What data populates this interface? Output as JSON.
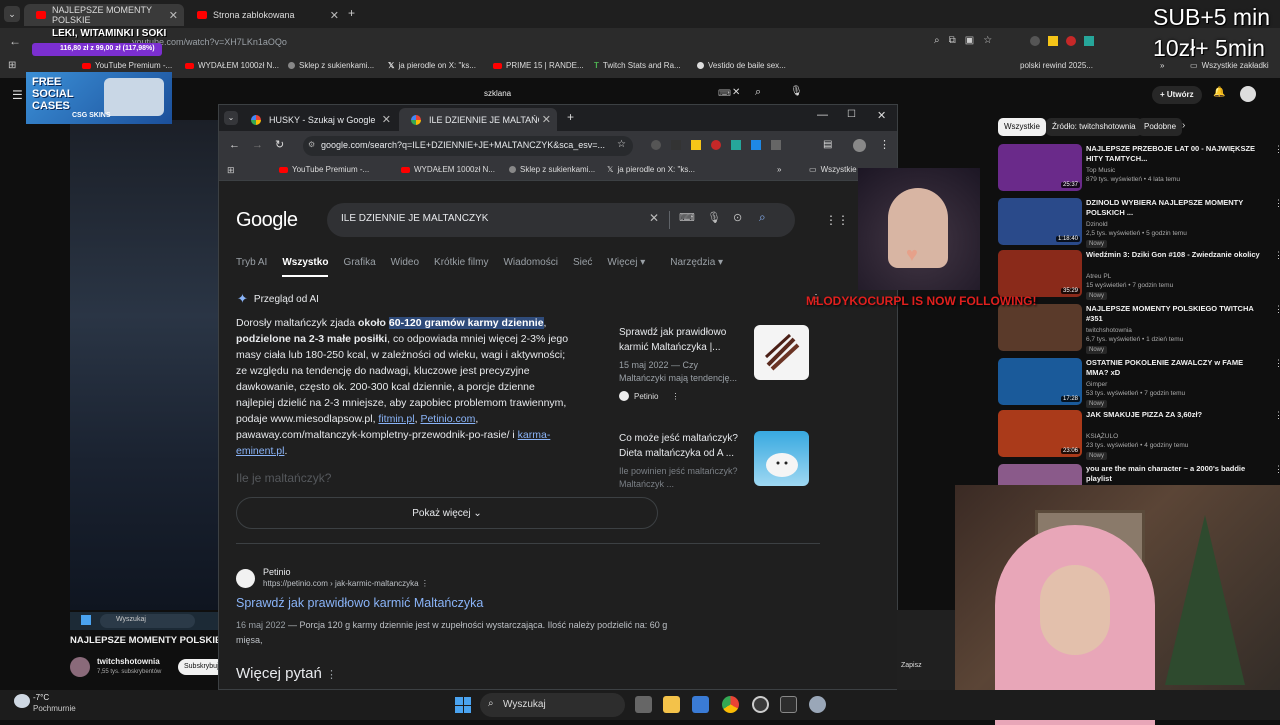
{
  "outer": {
    "tabs": [
      {
        "label": "NAJLEPSZE MOMENTY POLSKIE"
      },
      {
        "label": "Strona zablokowana"
      }
    ],
    "url": "youtube.com/watch?v=XH7LKn1aOQo",
    "bookmarks": [
      "YouTube Premium -...",
      "WYDAŁEM 1000zł N...",
      "Sklep z sukienkami...",
      "ja pierodle on X: \"ks...",
      "PRIME 15 | RANDE...",
      "Twitch Stats and Ra...",
      "Vestido de baile sex...",
      "polski rewind 2025...",
      "Wszystkie zakładki"
    ],
    "yt_search_value": "szklana",
    "create_label": "Utwórz"
  },
  "promo": {
    "line1": "LEKI, WITAMINKI I SOKI",
    "line2": "116,80 zł z 99,00 zł (117,98%)",
    "progress_fraction": 1.0,
    "brand_title": "FREE SOCIAL CASES",
    "brand_sub": "CSG SKINS"
  },
  "inner": {
    "tabs": [
      {
        "label": "HUSKY - Szukaj w Google"
      },
      {
        "label": "ILE DZIENNIE JE MALTAŃCZYK"
      }
    ],
    "url": "google.com/search?q=ILE+DZIENNIE+JE+MALTANCZYK&sca_esv=...",
    "bookmarks": [
      "YouTube Premium -...",
      "WYDAŁEM 1000zł N...",
      "Sklep z sukienkami...",
      "ja pierodle on X: \"ks...",
      "Wszystkie"
    ]
  },
  "google": {
    "logo": "Google",
    "query": "ILE DZIENNIE JE MALTANCZYK",
    "tabs": [
      "Tryb AI",
      "Wszystko",
      "Grafika",
      "Wideo",
      "Krótkie filmy",
      "Wiadomości",
      "Sieć",
      "Więcej",
      "Narzędzia"
    ],
    "ai_heading": "Przegląd od AI",
    "ai": {
      "p1": "Dorosły maltańczyk zjada ",
      "p2": "około ",
      "p3": "60-120 gramów karmy dziennie",
      "p4": ",",
      "p5": "podzielone na 2-3 małe posiłki",
      "p6": ", co odpowiada mniej więcej 2-3% jego masy ciała lub 180-250 kcal, w zależności od wieku, wagi i aktywności; ze względu na tendencję do nadwagi, kluczowe jest precyzyjne dawkowanie, często ok. 200-300 kcal dziennie, a porcje dzienne najlepiej dzielić na 2-3 mniejsze, aby zapobiec problemom trawiennym, podaje www.miesodlapsow.pl, ",
      "l1": "fitmin.pl",
      "sep": ", ",
      "l2": "Petinio.com",
      "p7": ", pawaway.com/maltanczyk-kompletny-przewodnik-po-rasie/ i ",
      "l3": "karma-eminent.pl",
      "p8": "."
    },
    "faded_question": "Ile je maltańczyk?",
    "cards": [
      {
        "title": "Sprawdź jak prawidłowo karmić Maltańczyka |...",
        "meta": "15 maj 2022 — Czy Maltańczyki mają tendencję...",
        "source": "Petinio"
      },
      {
        "title": "Co może jeść maltańczyk? Dieta maltańczyka od A ...",
        "meta": "Ile powinien jeść maltańczyk? Maltańczyk ..."
      }
    ],
    "show_more": "Pokaż więcej",
    "result": {
      "site": "Petinio",
      "url": "https://petinio.com › jak-karmic-maltanczyka",
      "title": "Sprawdź jak prawidłowo karmić Maltańczyka",
      "snippet_date": "16 maj 2022",
      "snippet": " — Porcja 120 g karmy dziennie jest w zupełności wystarczająca. Ilość należy podzielić na: 60 g mięsa,"
    },
    "more_questions": "Więcej pytań"
  },
  "youtube": {
    "chips": [
      "Wszystkie",
      "Źródło: twitchshotownia",
      "Podobne"
    ],
    "videos": [
      {
        "title": "NAJLEPSZE PRZEBOJE LAT 00 - NAJWIĘKSZE HITY TAMTYCH...",
        "channel": "Top Music",
        "stats": "879 tys. wyświetleń • 4 lata temu",
        "duration": "25:37",
        "color": "#6a2a8a"
      },
      {
        "title": "DZINOLD WYBIERA NAJLEPSZE MOMENTY POLSKICH ...",
        "channel": "Dzinold",
        "stats": "2,5 tys. wyświetleń • 5 godzin temu",
        "badge": "Nowy",
        "duration": "1:18:40",
        "color": "#2a4a8a"
      },
      {
        "title": "Wiedźmin 3: Dziki Gon #108 - Zwiedzanie okolicy",
        "channel": "Atreu PL",
        "stats": "15 wyświetleń • 7 godzin temu",
        "badge": "Nowy",
        "duration": "35:29",
        "color": "#8a2a1a"
      },
      {
        "title": "NAJLEPSZE MOMENTY POLSKIEGO TWITCHA #351",
        "channel": "twitchshotownia",
        "stats": "6,7 tys. wyświetleń • 1 dzień temu",
        "badge": "Nowy",
        "duration": "",
        "color": "#5a3a2a"
      },
      {
        "title": "OSTATNIE POKOLENIE ZAWALCZY w FAME MMA? xD",
        "channel": "Gimper",
        "stats": "53 tys. wyświetleń • 7 godzin temu",
        "badge": "Nowy",
        "duration": "17:28",
        "color": "#1a5a9a"
      },
      {
        "title": "JAK SMAKUJE PIZZA ZA 3,60zł?",
        "channel": "KSIĄŻULO",
        "stats": "23 tys. wyświetleń • 4 godziny temu",
        "badge": "Nowy",
        "duration": "23:06",
        "color": "#aa3a1a"
      },
      {
        "title": "you are the main character ~ a 2000's baddie playlist",
        "channel": "",
        "stats": "",
        "duration": "",
        "color": "#8a5a8a"
      }
    ]
  },
  "stream": {
    "sub_line1": "SUB+5 min",
    "sub_line2": "10zł+ 5min",
    "follow_name": "MLODYKOCURPL",
    "follow_text": " IS NOW FOLLOWING!"
  },
  "left": {
    "search_label": "Wyszukaj",
    "video_title": "NAJLEPSZE MOMENTY POLSKIE",
    "channel": "twitchshotownia",
    "subs": "7,55 tys. subskrybentów",
    "subscribe": "Subskrybuj"
  },
  "taskbar": {
    "weather_temp": "-7°C",
    "weather_desc": "Pochmurnie",
    "search_label": "Wyszukaj"
  },
  "right_edge": {
    "label1": "Zapisz"
  }
}
